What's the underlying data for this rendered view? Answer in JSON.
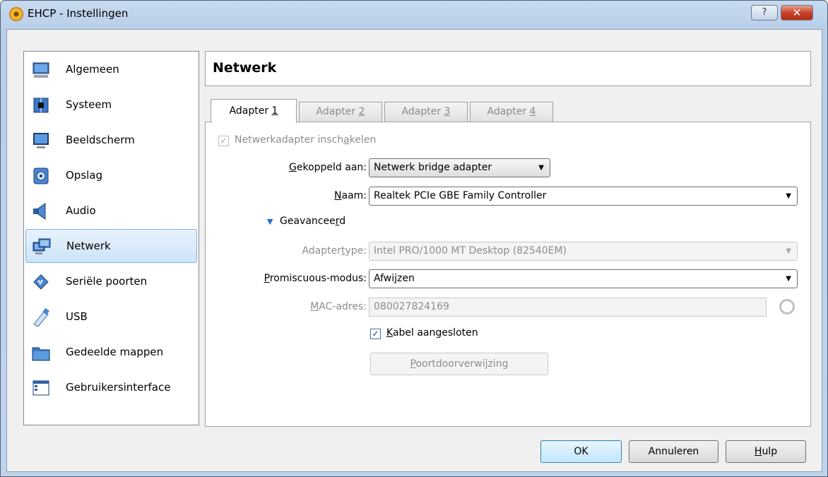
{
  "window": {
    "title": "EHCP - Instellingen",
    "help_label": "?",
    "close_label": "✕"
  },
  "sidebar": {
    "items": [
      {
        "label": "Algemeen",
        "icon": "monitor-icon"
      },
      {
        "label": "Systeem",
        "icon": "chip-icon"
      },
      {
        "label": "Beeldscherm",
        "icon": "display-icon"
      },
      {
        "label": "Opslag",
        "icon": "disk-icon"
      },
      {
        "label": "Audio",
        "icon": "speaker-icon"
      },
      {
        "label": "Netwerk",
        "icon": "network-icon",
        "selected": true
      },
      {
        "label": "Seriële poorten",
        "icon": "serial-port-icon"
      },
      {
        "label": "USB",
        "icon": "usb-icon"
      },
      {
        "label": "Gedeelde mappen",
        "icon": "folder-icon"
      },
      {
        "label": "Gebruikersinterface",
        "icon": "ui-window-icon"
      }
    ]
  },
  "page": {
    "title": "Netwerk"
  },
  "tabs": [
    {
      "pre": "Adapter ",
      "key": "1",
      "active": true
    },
    {
      "pre": "Adapter ",
      "key": "2",
      "active": false
    },
    {
      "pre": "Adapter ",
      "key": "3",
      "active": false
    },
    {
      "pre": "Adapter ",
      "key": "4",
      "active": false
    }
  ],
  "form": {
    "enable_adapter": {
      "pre": "Netwerkadapter insch",
      "key": "a",
      "post": "kelen",
      "checked": true,
      "disabled": true
    },
    "attached_to": {
      "pre": "",
      "key": "G",
      "post": "ekoppeld aan:",
      "value": "Netwerk bridge adapter"
    },
    "name": {
      "pre": "",
      "key": "N",
      "post": "aam:",
      "value": "Realtek PCIe GBE Family Controller"
    },
    "advanced": {
      "pre": "Geavancee",
      "key": "r",
      "post": "d"
    },
    "adapter_type": {
      "pre": "Adapter",
      "key": "t",
      "post": "ype:",
      "value": "Intel PRO/1000 MT Desktop (82540EM)"
    },
    "promiscuous": {
      "pre": "",
      "key": "P",
      "post": "romiscuous-modus:",
      "value": "Afwijzen"
    },
    "mac": {
      "pre": "",
      "key": "M",
      "post": "AC-adres:",
      "value": "080027824169"
    },
    "cable": {
      "pre": "",
      "key": "K",
      "post": "abel aangesloten",
      "checked": true
    },
    "port_forward": {
      "pre": "",
      "key": "P",
      "post": "oortdoorverwijzing"
    }
  },
  "buttons": {
    "ok": "OK",
    "cancel": "Annuleren",
    "help": {
      "pre": "",
      "key": "H",
      "post": "ulp"
    }
  }
}
